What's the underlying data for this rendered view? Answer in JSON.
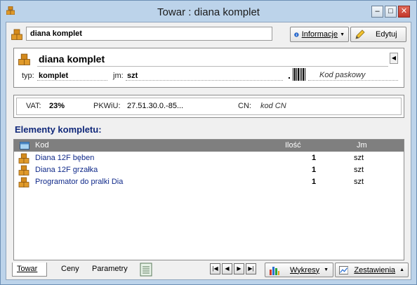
{
  "window": {
    "title": "Towar : diana komplet",
    "controls": {
      "minimize": "‒",
      "maximize": "□",
      "close": "✕"
    }
  },
  "toolbar": {
    "name_value": "diana komplet",
    "info_label": "Informacje",
    "edit_label": "Edytuj"
  },
  "header": {
    "product_name": "diana komplet",
    "type_label": "typ:",
    "type_value": "komplet",
    "unit_label": "jm:",
    "unit_value": "szt",
    "barcode_placeholder": "Kod paskowy"
  },
  "tax": {
    "vat_label": "VAT:",
    "vat_value": "23%",
    "pkwiu_label": "PKWiU:",
    "pkwiu_value": "27.51.30.0.-85...",
    "cn_label": "CN:",
    "cn_value": "kod CN"
  },
  "components": {
    "section_title": "Elementy kompletu:",
    "columns": {
      "code": "Kod",
      "qty": "Ilość",
      "unit": "Jm"
    },
    "rows": [
      {
        "code": "Diana 12F bęben",
        "qty": "1",
        "unit": "szt"
      },
      {
        "code": "Diana 12F grzałka",
        "qty": "1",
        "unit": "szt"
      },
      {
        "code": "Programator do pralki Dia",
        "qty": "1",
        "unit": "szt"
      }
    ]
  },
  "tabs": [
    {
      "label": "Towar",
      "active": true
    },
    {
      "label": "Ceny",
      "active": false
    },
    {
      "label": "Parametry",
      "active": false
    }
  ],
  "bottom": {
    "charts_label": "Wykresy",
    "summary_label": "Zestawienia"
  },
  "colors": {
    "section_title": "#10287a",
    "grid_header": "#7f7f7f",
    "window_frame": "#bcd3ea",
    "close_button": "#c2362a"
  }
}
